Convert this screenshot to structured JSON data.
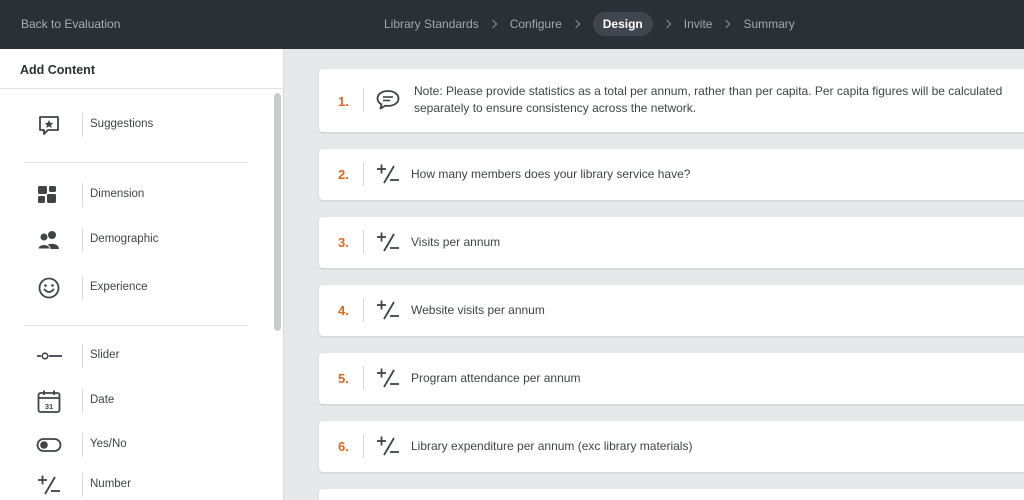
{
  "topbar": {
    "back_label": "Back to Evaluation",
    "steps": [
      {
        "label": "Library Standards",
        "active": false
      },
      {
        "label": "Configure",
        "active": false
      },
      {
        "label": "Design",
        "active": true
      },
      {
        "label": "Invite",
        "active": false
      },
      {
        "label": "Summary",
        "active": false
      }
    ]
  },
  "sidebar": {
    "title": "Add Content",
    "items": [
      {
        "label": "Suggestions",
        "icon": "suggestions-icon"
      },
      {
        "label": "Dimension",
        "icon": "dimension-icon"
      },
      {
        "label": "Demographic",
        "icon": "demographic-icon"
      },
      {
        "label": "Experience",
        "icon": "smiley-icon"
      },
      {
        "label": "Slider",
        "icon": "slider-icon"
      },
      {
        "label": "Date",
        "icon": "calendar-icon"
      },
      {
        "label": "Yes/No",
        "icon": "toggle-icon"
      },
      {
        "label": "Number",
        "icon": "plus-minus-icon"
      }
    ],
    "date_icon_day": "31"
  },
  "questions": [
    {
      "number": "1.",
      "type": "note",
      "icon": "speech-bubble-icon",
      "text": "Note: Please provide statistics as a total per annum, rather than per capita. Per capita figures will be calculated separately to ensure consistency across the network."
    },
    {
      "number": "2.",
      "type": "number",
      "icon": "plus-minus-icon",
      "text": "How many members does your library service have?"
    },
    {
      "number": "3.",
      "type": "number",
      "icon": "plus-minus-icon",
      "text": "Visits per annum"
    },
    {
      "number": "4.",
      "type": "number",
      "icon": "plus-minus-icon",
      "text": "Website visits per annum"
    },
    {
      "number": "5.",
      "type": "number",
      "icon": "plus-minus-icon",
      "text": "Program attendance per annum"
    },
    {
      "number": "6.",
      "type": "number",
      "icon": "plus-minus-icon",
      "text": "Library expenditure per annum (exc library materials)"
    }
  ],
  "colors": {
    "accent": "#e0661f",
    "topbar": "#2b3036",
    "background": "#e7e8ea"
  }
}
